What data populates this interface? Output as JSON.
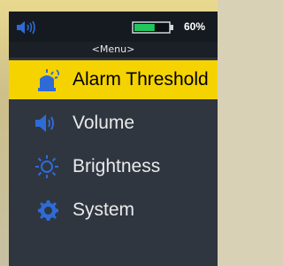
{
  "status": {
    "battery_percent_label": "60%",
    "battery_level": 0.6,
    "speaker_icon": "speaker-volume-icon",
    "battery_icon": "battery-icon"
  },
  "menu": {
    "title": "<Menu>",
    "items": [
      {
        "label": "Alarm Threshold",
        "icon": "alarm-light-icon",
        "selected": true
      },
      {
        "label": "Volume",
        "icon": "speaker-volume-icon",
        "selected": false
      },
      {
        "label": "Brightness",
        "icon": "sun-brightness-icon",
        "selected": false
      },
      {
        "label": "System",
        "icon": "gear-icon",
        "selected": false
      }
    ]
  },
  "colors": {
    "highlight": "#f5d300",
    "screen_bg": "#2f3640",
    "status_bg": "#151a20",
    "accent_blue": "#2f6bd6",
    "battery_green": "#22c55e"
  }
}
